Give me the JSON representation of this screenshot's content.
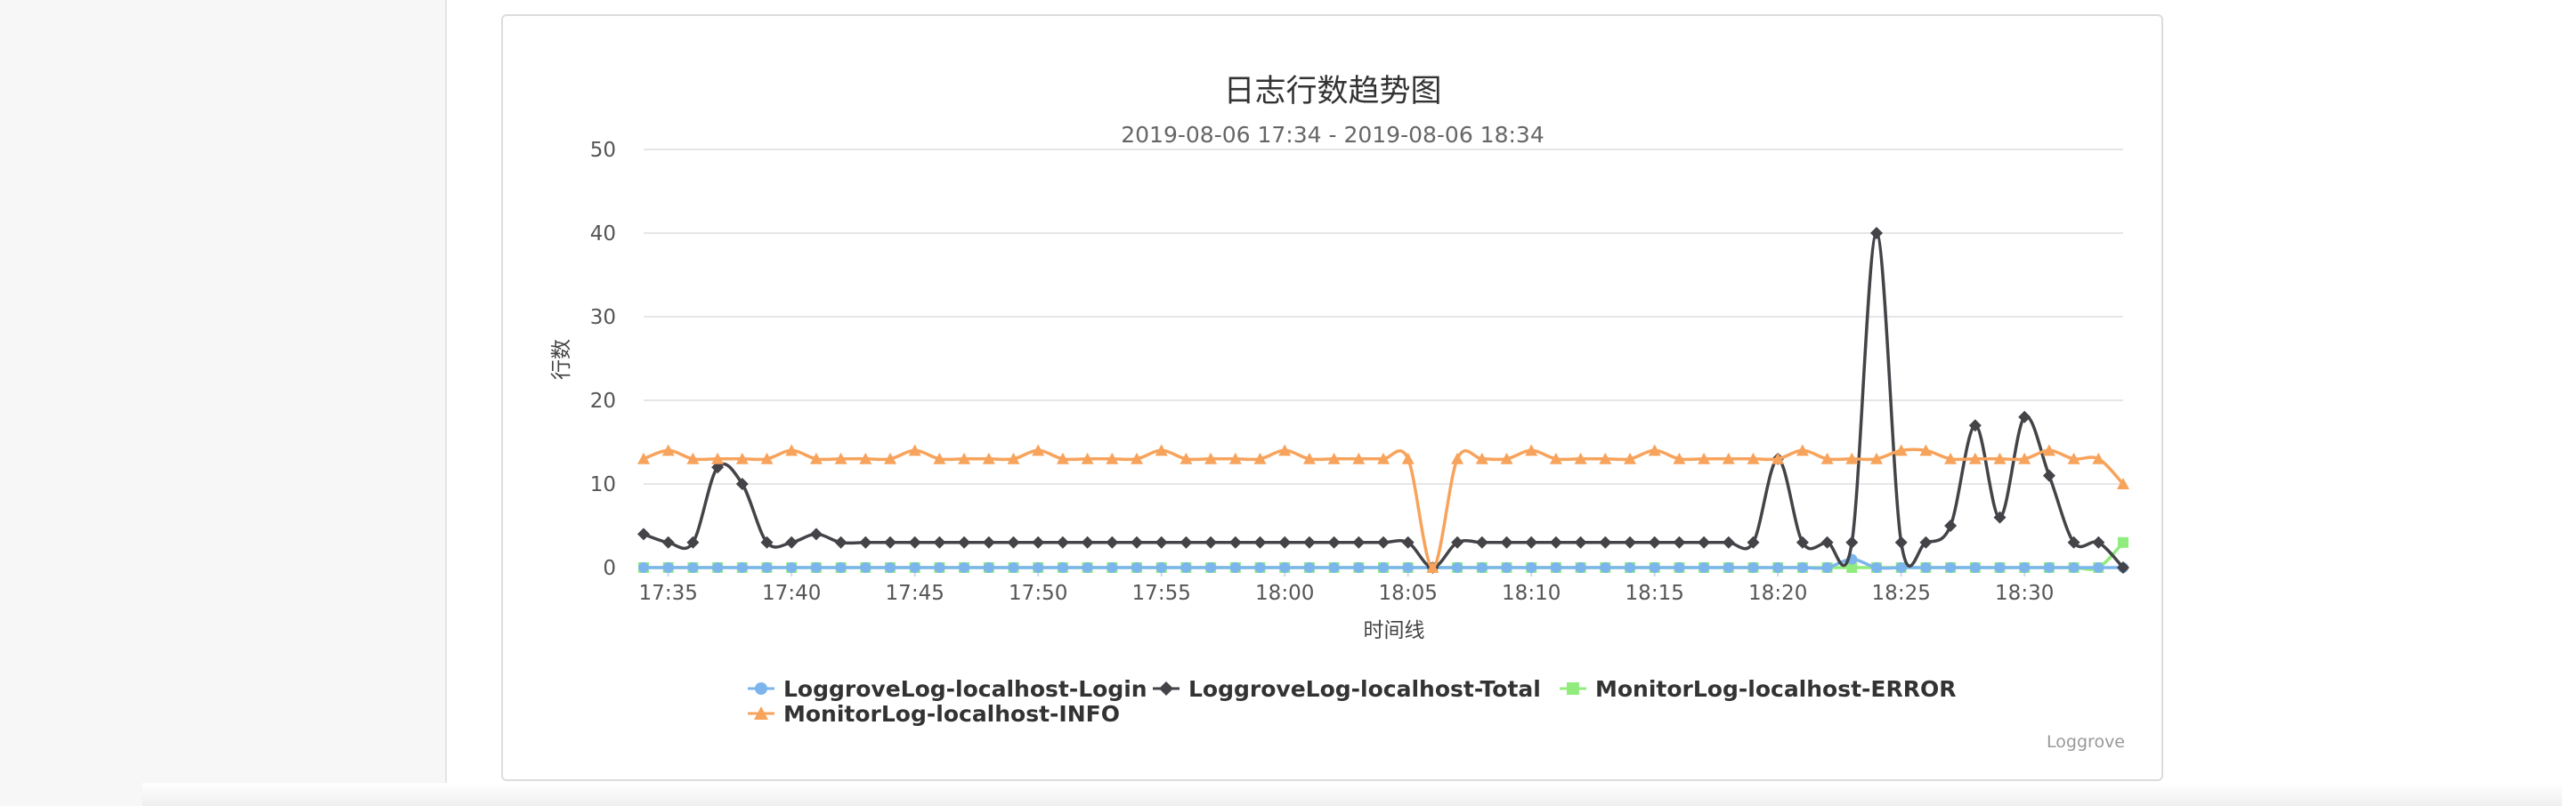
{
  "chart_data": {
    "type": "line",
    "title": "日志行数趋势图",
    "subtitle": "2019-08-06 17:34 - 2019-08-06 18:34",
    "xlabel": "时间线",
    "ylabel": "行数",
    "ylim": [
      0,
      50
    ],
    "yticks": [
      "0",
      "10",
      "20",
      "30",
      "40",
      "50"
    ],
    "xlim": [
      "17:34",
      "18:34"
    ],
    "xticks": [
      "17:35",
      "17:40",
      "17:45",
      "17:50",
      "17:55",
      "18:00",
      "18:05",
      "18:10",
      "18:15",
      "18:20",
      "18:25",
      "18:30"
    ],
    "x": [
      "17:34",
      "17:35",
      "17:36",
      "17:37",
      "17:38",
      "17:39",
      "17:40",
      "17:41",
      "17:42",
      "17:43",
      "17:44",
      "17:45",
      "17:46",
      "17:47",
      "17:48",
      "17:49",
      "17:50",
      "17:51",
      "17:52",
      "17:53",
      "17:54",
      "17:55",
      "17:56",
      "17:57",
      "17:58",
      "17:59",
      "18:00",
      "18:01",
      "18:02",
      "18:03",
      "18:04",
      "18:05",
      "18:06",
      "18:07",
      "18:08",
      "18:09",
      "18:10",
      "18:11",
      "18:12",
      "18:13",
      "18:14",
      "18:15",
      "18:16",
      "18:17",
      "18:18",
      "18:19",
      "18:20",
      "18:21",
      "18:22",
      "18:23",
      "18:24",
      "18:25",
      "18:26",
      "18:27",
      "18:28",
      "18:29",
      "18:30",
      "18:31",
      "18:32",
      "18:33",
      "18:34"
    ],
    "grid": true,
    "legend_position": "bottom-center",
    "series": [
      {
        "name": "LoggroveLog-localhost-Login",
        "color": "#7cb5ec",
        "marker": "circle",
        "values": [
          0,
          0,
          0,
          0,
          0,
          0,
          0,
          0,
          0,
          0,
          0,
          0,
          0,
          0,
          0,
          0,
          0,
          0,
          0,
          0,
          0,
          0,
          0,
          0,
          0,
          0,
          0,
          0,
          0,
          0,
          0,
          0,
          0,
          0,
          0,
          0,
          0,
          0,
          0,
          0,
          0,
          0,
          0,
          0,
          0,
          0,
          0,
          0,
          0,
          1,
          0,
          0,
          0,
          0,
          0,
          0,
          0,
          0,
          0,
          0,
          0
        ]
      },
      {
        "name": "LoggroveLog-localhost-Total",
        "color": "#434348",
        "marker": "diamond",
        "values": [
          4,
          3,
          3,
          12,
          10,
          3,
          3,
          4,
          3,
          3,
          3,
          3,
          3,
          3,
          3,
          3,
          3,
          3,
          3,
          3,
          3,
          3,
          3,
          3,
          3,
          3,
          3,
          3,
          3,
          3,
          3,
          3,
          0,
          3,
          3,
          3,
          3,
          3,
          3,
          3,
          3,
          3,
          3,
          3,
          3,
          3,
          13,
          3,
          3,
          3,
          40,
          3,
          3,
          5,
          17,
          6,
          18,
          11,
          3,
          3,
          0
        ]
      },
      {
        "name": "MonitorLog-localhost-ERROR",
        "color": "#90ed7d",
        "marker": "square",
        "values": [
          0,
          0,
          0,
          0,
          0,
          0,
          0,
          0,
          0,
          0,
          0,
          0,
          0,
          0,
          0,
          0,
          0,
          0,
          0,
          0,
          0,
          0,
          0,
          0,
          0,
          0,
          0,
          0,
          0,
          0,
          0,
          0,
          0,
          0,
          0,
          0,
          0,
          0,
          0,
          0,
          0,
          0,
          0,
          0,
          0,
          0,
          0,
          0,
          0,
          0,
          0,
          0,
          0,
          0,
          0,
          0,
          0,
          0,
          0,
          0,
          3
        ]
      },
      {
        "name": "MonitorLog-localhost-INFO",
        "color": "#f7a35c",
        "marker": "triangle",
        "values": [
          13,
          14,
          13,
          13,
          13,
          13,
          14,
          13,
          13,
          13,
          13,
          14,
          13,
          13,
          13,
          13,
          14,
          13,
          13,
          13,
          13,
          14,
          13,
          13,
          13,
          13,
          14,
          13,
          13,
          13,
          13,
          13,
          0,
          13,
          13,
          13,
          14,
          13,
          13,
          13,
          13,
          14,
          13,
          13,
          13,
          13,
          13,
          14,
          13,
          13,
          13,
          14,
          14,
          13,
          13,
          13,
          13,
          14,
          13,
          13,
          10
        ]
      }
    ],
    "credits": "Loggrove"
  }
}
